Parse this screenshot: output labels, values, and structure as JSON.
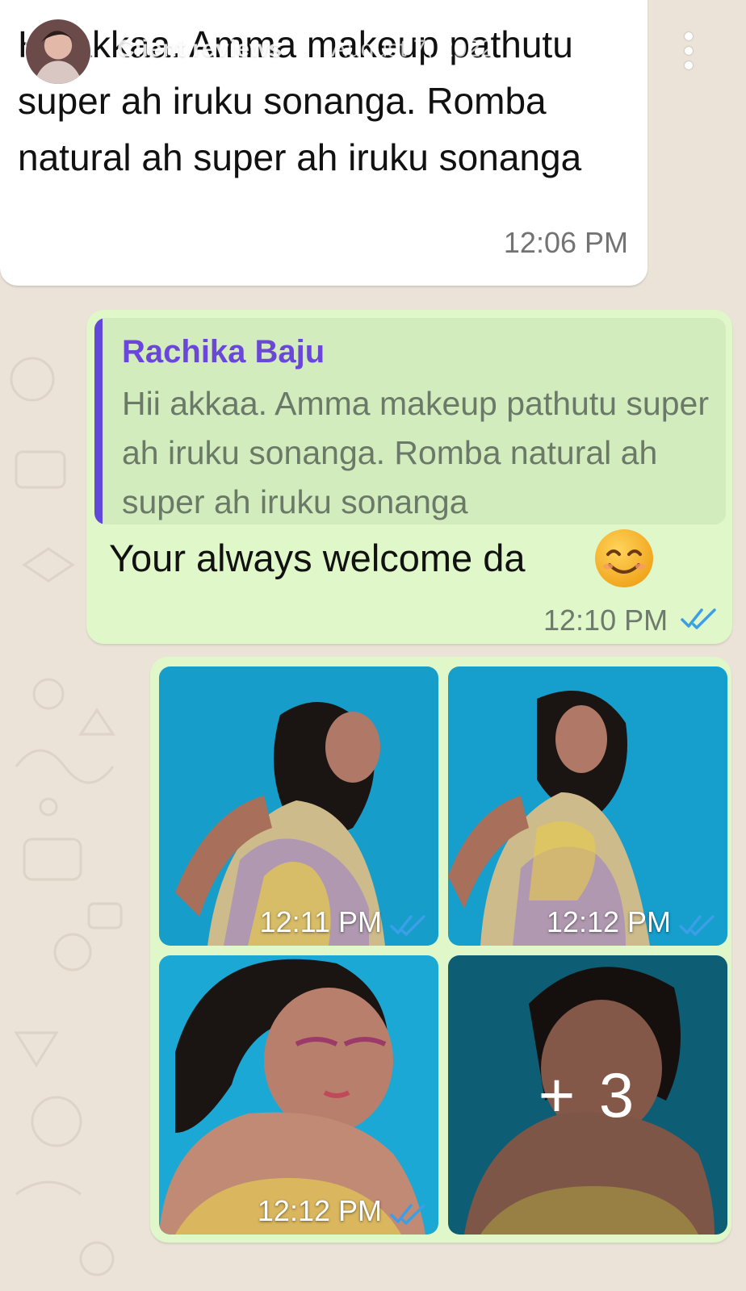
{
  "story": {
    "title": "Client reviews",
    "date": "August 7, 2022",
    "avatar_icon": "profile-avatar-icon",
    "menu_icon": "more-vertical-icon"
  },
  "chat": {
    "incoming": {
      "text": "Hii akkaa. Amma makeup pathutu super ah iruku sonanga. Romba natural ah super ah iruku sonanga",
      "time": "12:06 PM"
    },
    "outgoing": {
      "reply_author": "Rachika Baju",
      "reply_text": "Hii akkaa. Amma makeup pathutu super ah iruku sonanga. Romba natural ah super ah iruku sonanga",
      "message": "Your always welcome da",
      "emoji": "smiling-face-icon",
      "time": "12:10 PM",
      "status_icon": "double-check-icon"
    },
    "photos": [
      {
        "time": "12:11 PM",
        "status_icon": "double-check-icon"
      },
      {
        "time": "12:12 PM",
        "status_icon": "double-check-icon"
      },
      {
        "time": "12:12 PM",
        "status_icon": "double-check-icon"
      },
      {
        "overlay": "+ 3"
      }
    ]
  },
  "colors": {
    "wallpaper": "#ebe3d8",
    "incoming_bubble": "#ffffff",
    "outgoing_bubble": "#dff7c9",
    "quote_bar": "#6248d8",
    "quote_author": "#6a47d8",
    "read_ticks": "#3b9fe8",
    "photo_background": "#1ba8d4"
  }
}
